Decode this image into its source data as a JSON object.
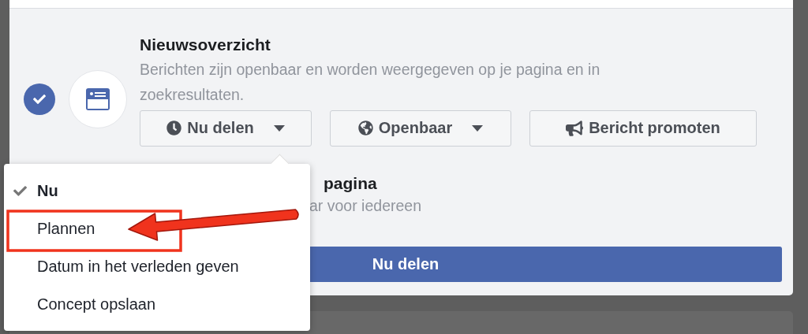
{
  "sections": [
    {
      "title": "Nieuwsoverzicht",
      "description": "Berichten zijn openbaar en worden weergegeven op je pagina en in zoekresultaten.",
      "checked": true,
      "buttons": [
        {
          "kind": "dropdown",
          "label": "Nu delen"
        },
        {
          "kind": "dropdown",
          "label": "Openbaar"
        },
        {
          "kind": "plain",
          "label": "Bericht promoten"
        }
      ]
    },
    {
      "title": "pagina",
      "description": "ar voor iedereen"
    }
  ],
  "submit": "Nu delen",
  "menu": [
    {
      "label": "Nu",
      "selected": true
    },
    {
      "label": "Plannen",
      "selected": false
    },
    {
      "label": "Datum in het verleden geven",
      "selected": false
    },
    {
      "label": "Concept opslaan",
      "selected": false
    }
  ]
}
